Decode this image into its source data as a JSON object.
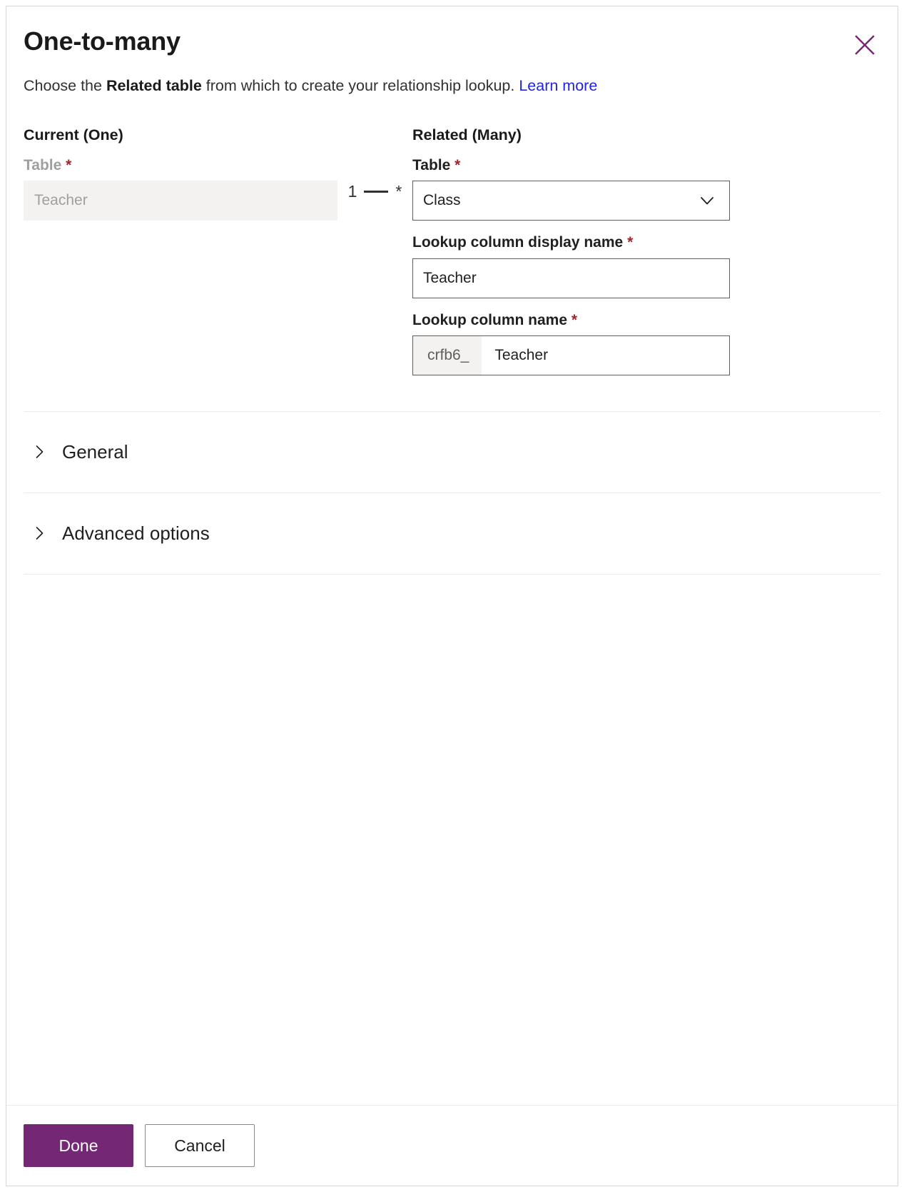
{
  "dialog": {
    "title": "One-to-many",
    "close_icon": "close-icon",
    "description": {
      "prefix": "Choose the ",
      "bold": "Related table",
      "suffix": " from which to create your relationship lookup. ",
      "link": "Learn more"
    }
  },
  "colors": {
    "primary": "#742774",
    "link": "#2323dc",
    "required_asterisk": "#a4262c",
    "close_icon": "#742774",
    "border": "#605e5c",
    "disabled_bg": "#f3f2f1"
  },
  "current": {
    "heading": "Current (One)",
    "table": {
      "label": "Table",
      "required_mark": "*",
      "value": "Teacher",
      "disabled": true
    }
  },
  "cardinality": {
    "one": "1",
    "many": "*"
  },
  "related": {
    "heading": "Related (Many)",
    "table": {
      "label": "Table",
      "required_mark": "*",
      "value": "Class",
      "chevron_icon": "chevron-down-icon"
    },
    "display_name": {
      "label": "Lookup column display name",
      "required_mark": "*",
      "value": "Teacher"
    },
    "column_name": {
      "label": "Lookup column name",
      "required_mark": "*",
      "prefix": "crfb6_",
      "value": "Teacher"
    }
  },
  "sections": [
    {
      "label": "General",
      "expanded": false,
      "chevron_icon": "chevron-right-icon"
    },
    {
      "label": "Advanced options",
      "expanded": false,
      "chevron_icon": "chevron-right-icon"
    }
  ],
  "footer": {
    "done_label": "Done",
    "cancel_label": "Cancel"
  }
}
